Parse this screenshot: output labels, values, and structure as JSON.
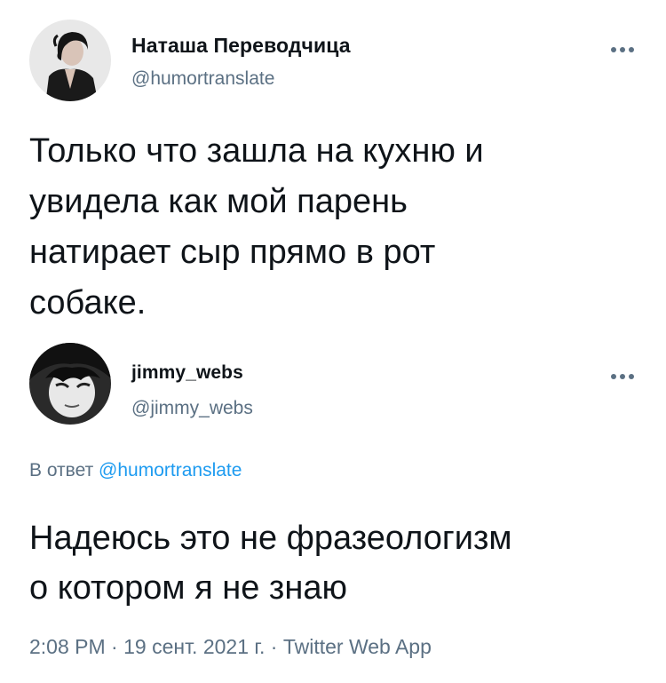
{
  "tweet": {
    "author": {
      "name": "Наташа Переводчица",
      "handle": "@humortranslate"
    },
    "text": "Только что зашла на кухню и\nувидела как мой парень\nнатирает сыр прямо в рот\nсобаке."
  },
  "reply": {
    "author": {
      "name": "jimmy_webs",
      "handle": "@jimmy_webs"
    },
    "replying_to_prefix": "В ответ",
    "replying_to_handle": "@humortranslate",
    "text": "Надеюсь это не фразеологизм\nо котором я не знаю",
    "time": "2:08 PM",
    "separator_1": " · ",
    "date": "19 сент. 2021 г.",
    "separator_2": " · ",
    "source": "Twitter Web App"
  },
  "icons": {
    "more": "more-options-icon"
  },
  "colors": {
    "text": "#0f1419",
    "secondary": "#5b7083",
    "link": "#1d9bf0"
  }
}
